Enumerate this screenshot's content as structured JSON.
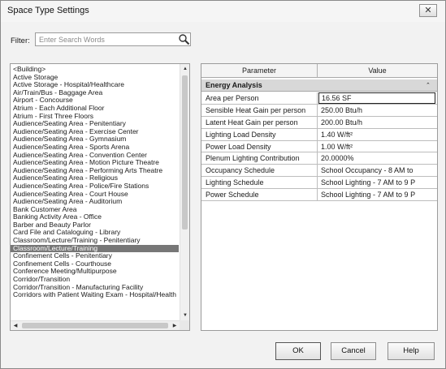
{
  "window": {
    "title": "Space Type Settings",
    "close_label": "✕"
  },
  "filter": {
    "label": "Filter:",
    "placeholder": "Enter Search Words"
  },
  "space_types": {
    "items": [
      "<Building>",
      "Active Storage",
      "Active Storage - Hospital/Healthcare",
      "Air/Train/Bus - Baggage Area",
      "Airport - Concourse",
      "Atrium - Each Additional Floor",
      "Atrium - First Three Floors",
      "Audience/Seating Area - Penitentiary",
      "Audience/Seating Area - Exercise Center",
      "Audience/Seating Area - Gymnasium",
      "Audience/Seating Area - Sports Arena",
      "Audience/Seating Area - Convention Center",
      "Audience/Seating Area - Motion Picture Theatre",
      "Audience/Seating Area - Performing Arts Theatre",
      "Audience/Seating Area - Religious",
      "Audience/Seating Area - Police/Fire Stations",
      "Audience/Seating Area - Court House",
      "Audience/Seating Area - Auditorium",
      "Bank Customer Area",
      "Banking Activity Area - Office",
      "Barber and Beauty Parlor",
      "Card File and Cataloguing - Library",
      "Classroom/Lecture/Training - Penitentiary",
      "Classroom/Lecture/Training",
      "Confinement Cells - Penitentiary",
      "Confinement Cells - Courthouse",
      "Conference Meeting/Multipurpose",
      "Corridor/Transition",
      "Corridor/Transition - Manufacturing Facility",
      "Corridors with Patient Waiting Exam - Hospital/Health"
    ],
    "selected_index": 23
  },
  "grid": {
    "param_header": "Parameter",
    "value_header": "Value",
    "group": "Energy Analysis",
    "group_toggle": "⌃",
    "rows": [
      {
        "name": "Area per Person",
        "value": "16.56 SF"
      },
      {
        "name": "Sensible Heat Gain per person",
        "value": "250.00 Btu/h"
      },
      {
        "name": "Latent Heat Gain per person",
        "value": "200.00 Btu/h"
      },
      {
        "name": "Lighting Load Density",
        "value": "1.40 W/ft²"
      },
      {
        "name": "Power Load Density",
        "value": "1.00 W/ft²"
      },
      {
        "name": "Plenum Lighting Contribution",
        "value": "20.0000%"
      },
      {
        "name": "Occupancy Schedule",
        "value": "School Occupancy - 8 AM to"
      },
      {
        "name": "Lighting Schedule",
        "value": "School Lighting - 7 AM to 9 P"
      },
      {
        "name": "Power Schedule",
        "value": "School Lighting - 7 AM to 9 P"
      }
    ]
  },
  "buttons": {
    "ok": "OK",
    "cancel": "Cancel",
    "help": "Help"
  }
}
